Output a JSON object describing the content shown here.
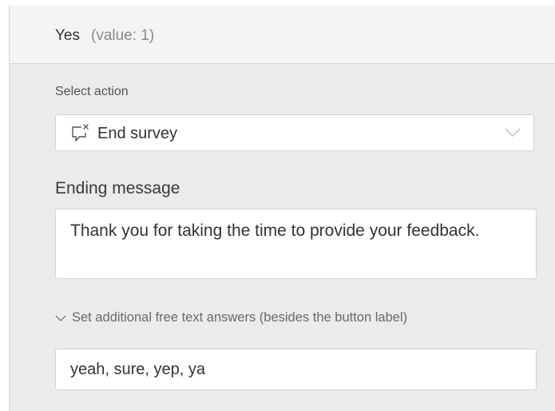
{
  "option": {
    "label": "Yes",
    "value_text": "(value: 1)"
  },
  "action": {
    "label": "Select action",
    "selected": "End survey",
    "icon": "end-survey-chat-icon"
  },
  "ending_message": {
    "label": "Ending message",
    "value": "Thank you for taking the time to provide your feedback."
  },
  "free_text": {
    "toggle_label": "Set additional free text answers (besides the button label)",
    "value": "yeah, sure, yep, ya"
  },
  "colors": {
    "panel_bg": "#ebebeb",
    "header_bg": "#f4f4f4",
    "field_bg": "#ffffff",
    "border": "#d4d4d4",
    "text": "#333333",
    "muted": "#8a8a8a"
  }
}
